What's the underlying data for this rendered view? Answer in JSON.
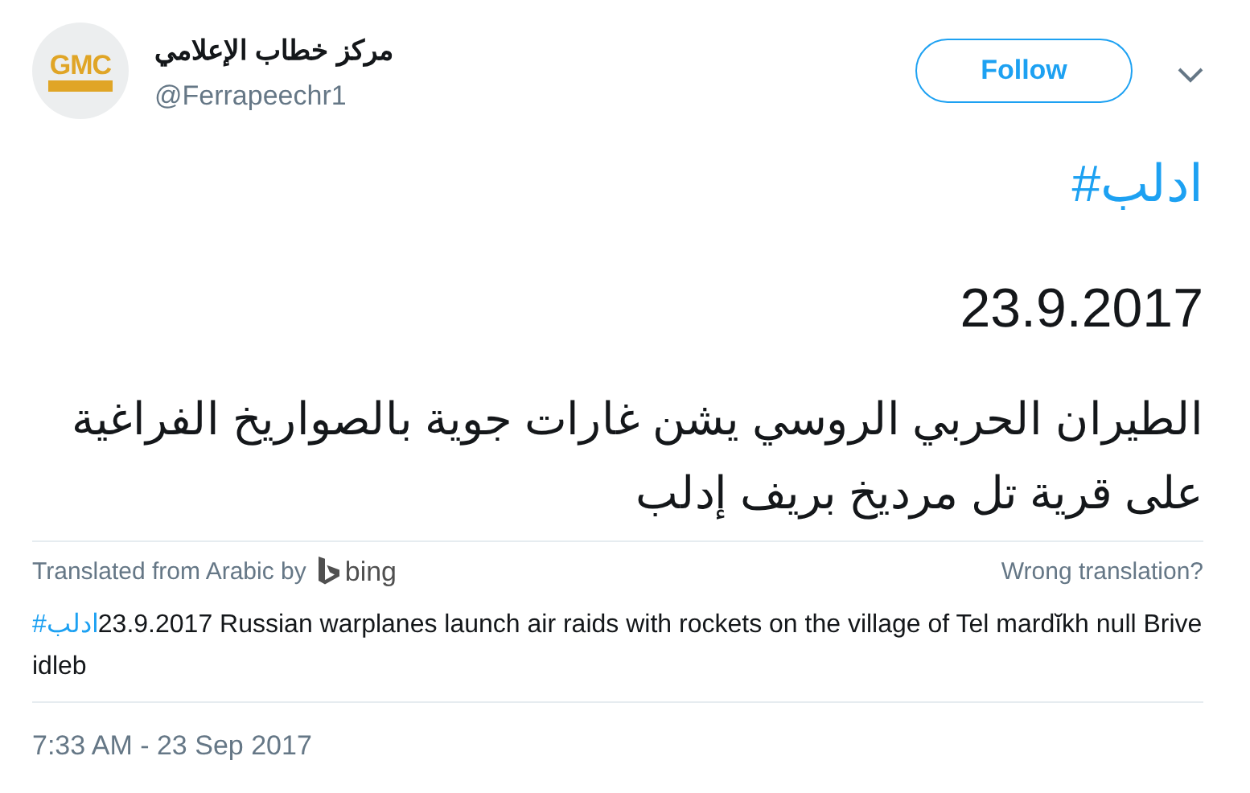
{
  "author": {
    "logo_text": "GMC",
    "name": "مركز خطاب الإعلامي",
    "handle": "@Ferrapeechr1"
  },
  "follow_button": {
    "label": "Follow"
  },
  "tweet": {
    "hashtag": "#ادلب",
    "date": "23.9.2017",
    "text": "الطيران الحربي الروسي يشن غارات جوية بالصواريخ الفراغية على قرية تل مرديخ بريف إدلب"
  },
  "translation": {
    "source": "Translated from Arabic by",
    "provider": "bing",
    "report_link": "Wrong translation?",
    "hashtag": "#ادلب",
    "text": "23.9.2017 Russian warplanes launch air raids with rockets on the village of Tel mardĭkh null Brive idleb"
  },
  "timestamp": "7:33 AM - 23 Sep 2017"
}
